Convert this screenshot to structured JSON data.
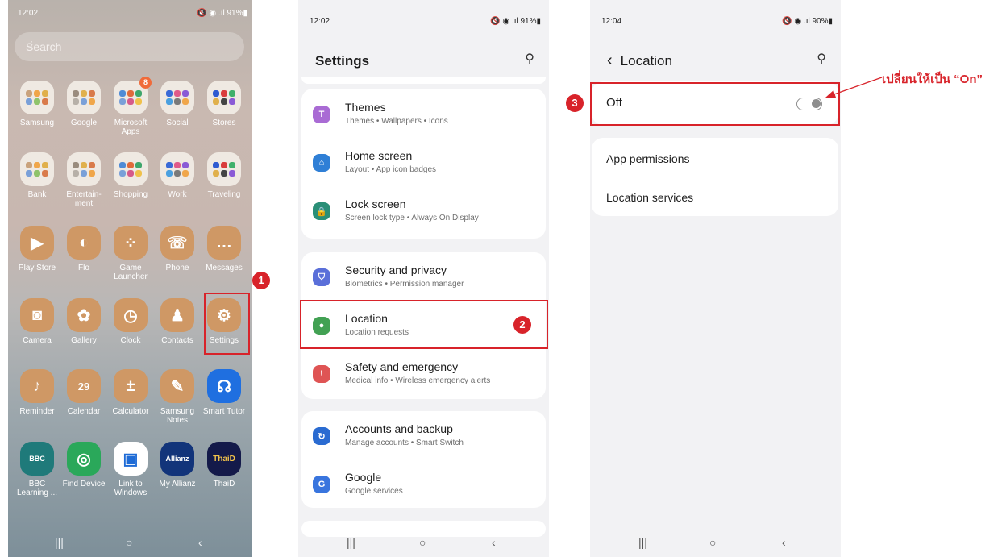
{
  "home": {
    "status_time": "12:02",
    "status_right": "🔇 ◉ .ıl 91%▮",
    "search_placeholder": "Search",
    "search_menu": "⋮",
    "apps": [
      {
        "label": "Samsung",
        "kind": "folder"
      },
      {
        "label": "Google",
        "kind": "folder"
      },
      {
        "label": "Microsoft Apps",
        "kind": "folder",
        "badge": "8"
      },
      {
        "label": "Social",
        "kind": "folder"
      },
      {
        "label": "Stores",
        "kind": "folder"
      },
      {
        "label": "Bank",
        "kind": "folder"
      },
      {
        "label": "Entertain-ment",
        "kind": "folder"
      },
      {
        "label": "Shopping",
        "kind": "folder"
      },
      {
        "label": "Work",
        "kind": "folder"
      },
      {
        "label": "Traveling",
        "kind": "folder"
      },
      {
        "label": "Play Store",
        "glyph": "▶"
      },
      {
        "label": "Flo",
        "glyph": "◐"
      },
      {
        "label": "Game Launcher",
        "glyph": "⁘"
      },
      {
        "label": "Phone",
        "glyph": "☏"
      },
      {
        "label": "Messages",
        "glyph": "…"
      },
      {
        "label": "Camera",
        "glyph": "◙"
      },
      {
        "label": "Gallery",
        "glyph": "✿"
      },
      {
        "label": "Clock",
        "glyph": "◷"
      },
      {
        "label": "Contacts",
        "glyph": "♟"
      },
      {
        "label": "Settings",
        "glyph": "⚙"
      },
      {
        "label": "Reminder",
        "glyph": "♪"
      },
      {
        "label": "Calendar",
        "glyph": "29"
      },
      {
        "label": "Calculator",
        "glyph": "±"
      },
      {
        "label": "Samsung Notes",
        "glyph": "✎"
      },
      {
        "label": "Smart Tutor",
        "glyph": "☊"
      },
      {
        "label": "BBC Learning ...",
        "glyph": "BBC"
      },
      {
        "label": "Find Device",
        "glyph": "◎"
      },
      {
        "label": "Link to Windows",
        "glyph": "▣"
      },
      {
        "label": "My Allianz",
        "glyph": "Allianz"
      },
      {
        "label": "ThaiD",
        "glyph": "ThaiD"
      }
    ],
    "nav": {
      "recent": "|||",
      "home": "○",
      "back": "‹"
    }
  },
  "settings": {
    "status_time": "12:02",
    "status_right": "🔇 ◉ .ıl 91%▮",
    "title": "Settings",
    "search_icon": "⚲",
    "groups": [
      [
        {
          "title": "Themes",
          "subtitle": "Themes • Wallpapers • Icons",
          "color": "#a96bd4",
          "glyph": "T"
        },
        {
          "title": "Home screen",
          "subtitle": "Layout • App icon badges",
          "color": "#2f7fd6",
          "glyph": "⌂"
        },
        {
          "title": "Lock screen",
          "subtitle": "Screen lock type • Always On Display",
          "color": "#2a8f77",
          "glyph": "🔒"
        }
      ],
      [
        {
          "title": "Security and privacy",
          "subtitle": "Biometrics • Permission manager",
          "color": "#5a6fd9",
          "glyph": "⛉"
        },
        {
          "title": "Location",
          "subtitle": "Location requests",
          "color": "#42a153",
          "glyph": "●"
        },
        {
          "title": "Safety and emergency",
          "subtitle": "Medical info • Wireless emergency alerts",
          "color": "#df5454",
          "glyph": "!"
        }
      ],
      [
        {
          "title": "Accounts and backup",
          "subtitle": "Manage accounts • Smart Switch",
          "color": "#2a6bd1",
          "glyph": "↻"
        },
        {
          "title": "Google",
          "subtitle": "Google services",
          "color": "#3975de",
          "glyph": "G"
        }
      ]
    ],
    "nav": {
      "recent": "|||",
      "home": "○",
      "back": "‹"
    }
  },
  "location": {
    "status_time": "12:04",
    "status_right": "🔇 ◉ .ıl 90%▮",
    "back": "‹",
    "title": "Location",
    "search_icon": "⚲",
    "toggle_label": "Off",
    "toggle_on": false,
    "items": [
      "App permissions",
      "Location services"
    ],
    "nav": {
      "recent": "|||",
      "home": "○",
      "back": "‹"
    }
  },
  "annotations": {
    "step1": "1",
    "step2": "2",
    "step3": "3",
    "note": "เปลี่ยนให้เป็น “On”",
    "color": "#d8232a"
  }
}
